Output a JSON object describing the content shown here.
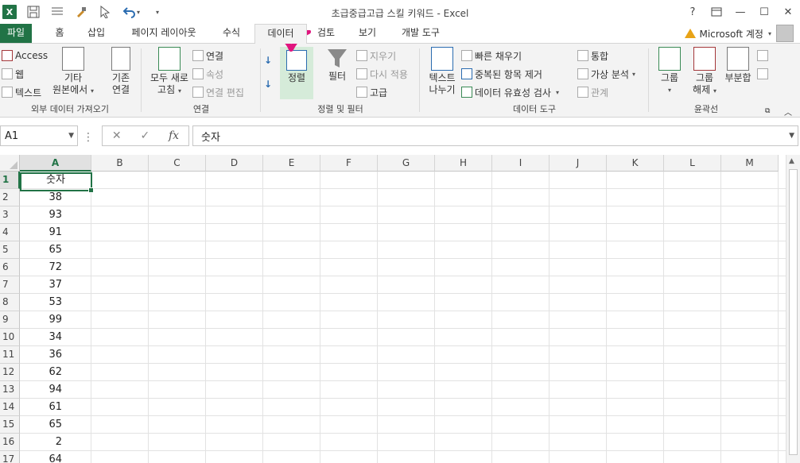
{
  "window": {
    "title": "초급중급고급 스킬 키워드 - Excel",
    "help": "?",
    "min": "—",
    "max": "☐",
    "close": "✕"
  },
  "tabs": {
    "file": "파일",
    "home": "홈",
    "insert": "삽입",
    "layout": "페이지 레이아웃",
    "formulas": "수식",
    "data": "데이터",
    "review": "검토",
    "view": "보기",
    "developer": "개발 도구"
  },
  "account": {
    "label": "Microsoft 계정"
  },
  "ribbon": {
    "get_external": {
      "access": "Access",
      "web": "웹",
      "text": "텍스트",
      "other": "기타",
      "other2": "원본에서",
      "existing": "기존",
      "existing2": "연결",
      "label": "외부 데이터 가져오기"
    },
    "connections": {
      "refresh_all": "모두 새로",
      "refresh_all2": "고침",
      "connections": "연결",
      "properties": "속성",
      "edit_links": "연결 편집",
      "label": "연결"
    },
    "sort_filter": {
      "sort_asc": "↓",
      "sort_desc": "↓",
      "sort": "정렬",
      "filter": "필터",
      "clear": "지우기",
      "reapply": "다시 적용",
      "advanced": "고급",
      "label": "정렬 및 필터"
    },
    "data_tools": {
      "text_to_columns": "텍스트",
      "text_to_columns2": "나누기",
      "flash_fill": "빠른 채우기",
      "remove_dupes": "중복된 항목 제거",
      "validation": "데이터 유효성 검사",
      "consolidate": "통합",
      "whatif": "가상 분석",
      "relationships": "관계",
      "label": "데이터 도구"
    },
    "outline": {
      "group": "그룹",
      "ungroup": "그룹",
      "ungroup2": "해제",
      "subtotal": "부분합",
      "label": "윤곽선"
    }
  },
  "formula_bar": {
    "name_box": "A1",
    "cancel": "✕",
    "enter": "✓",
    "fx": "fx",
    "content": "숫자"
  },
  "grid": {
    "columns": [
      "A",
      "B",
      "C",
      "D",
      "E",
      "F",
      "G",
      "H",
      "I",
      "J",
      "K",
      "L",
      "M"
    ],
    "rows": [
      "1",
      "2",
      "3",
      "4",
      "5",
      "6",
      "7",
      "8",
      "9",
      "10",
      "11",
      "12",
      "13",
      "14",
      "15",
      "16",
      "17"
    ],
    "colA": [
      "숫자",
      "38",
      "93",
      "91",
      "65",
      "72",
      "37",
      "53",
      "99",
      "34",
      "36",
      "62",
      "94",
      "61",
      "65",
      "2",
      "64"
    ]
  },
  "colors": {
    "accent": "#217346",
    "annotation": "#e0157e"
  }
}
